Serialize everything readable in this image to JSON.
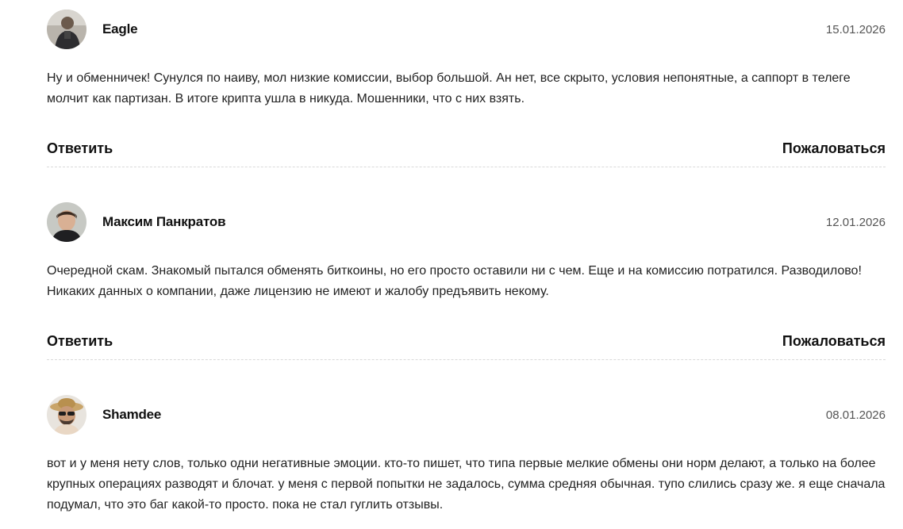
{
  "comments": [
    {
      "author": "Eagle",
      "date": "15.01.2026",
      "avatar": "eagle-avatar",
      "text": "Ну и обменничек! Сунулся по наиву, мол низкие комиссии, выбор большой. Ан нет, все скрыто, условия непонятные, а саппорт в телеге молчит как партизан. В итоге крипта ушла в никуда. Мошенники, что с них взять.",
      "reply_label": "Ответить",
      "report_label": "Пожаловаться"
    },
    {
      "author": "Максим Панкратов",
      "date": "12.01.2026",
      "avatar": "maksim-avatar",
      "text": "Очередной скам. Знакомый пытался обменять биткоины, но его просто оставили ни с чем. Еще и на комиссию потратился. Разводилово! Никаких данных о компании, даже лицензию не имеют и жалобу предъявить некому.",
      "reply_label": "Ответить",
      "report_label": "Пожаловаться"
    },
    {
      "author": "Shamdee",
      "date": "08.01.2026",
      "avatar": "shamdee-avatar",
      "text": "вот и у меня нету слов, только одни негативные эмоции. кто-то пишет, что типа первые мелкие обмены они норм делают, а только на более крупных операциях разводят и блочат. у меня с первой попытки не задалось, сумма средняя обычная. тупо слились сразу же. я еще сначала подумал, что это баг какой-то просто. пока не стал гуглить отзывы."
    }
  ]
}
